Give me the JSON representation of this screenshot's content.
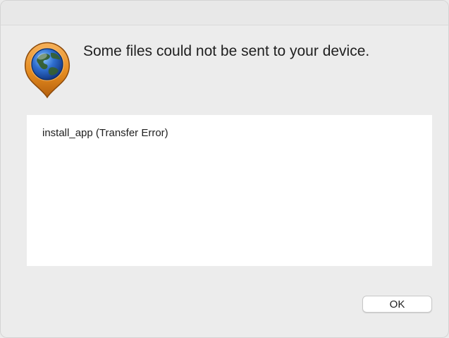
{
  "dialog": {
    "message": "Some files could not be sent to your device.",
    "icon": "globe-location-pin-icon",
    "details": [
      "install_app (Transfer Error)"
    ],
    "ok_label": "OK"
  },
  "colors": {
    "pin_orange": "#e48b1f",
    "globe_blue": "#2f6fd0",
    "background": "#ececec",
    "panel": "#ffffff"
  }
}
